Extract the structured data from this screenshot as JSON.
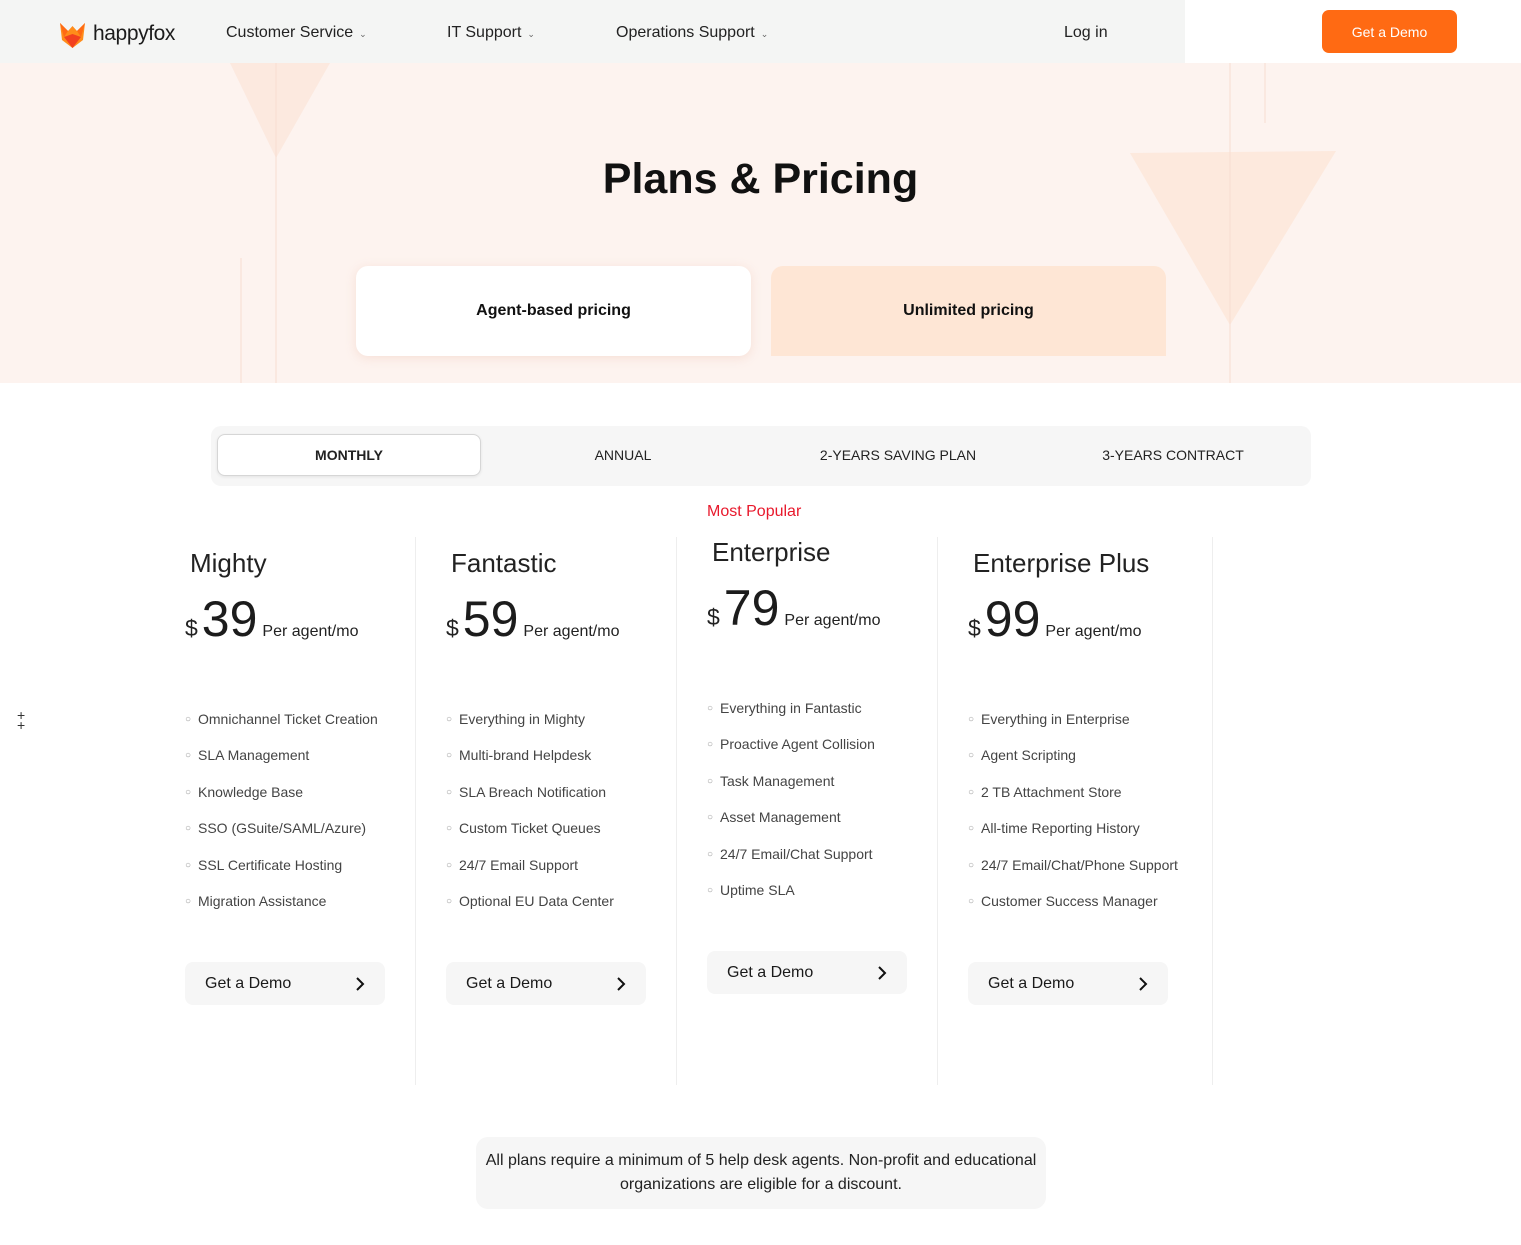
{
  "nav": {
    "brand": "happyfox",
    "items": [
      {
        "label": "Customer Service"
      },
      {
        "label": "IT Support"
      },
      {
        "label": "Operations Support"
      }
    ],
    "login": "Log in",
    "demo": "Get a Demo"
  },
  "hero": {
    "title": "Plans & Pricing",
    "tabs": [
      {
        "label": "Agent-based pricing",
        "selected": false
      },
      {
        "label": "Unlimited pricing",
        "selected": true
      }
    ]
  },
  "billing": {
    "options": [
      {
        "label": "MONTHLY",
        "selected": true
      },
      {
        "label": "ANNUAL",
        "selected": false
      },
      {
        "label": "2-YEARS SAVING PLAN",
        "selected": false
      },
      {
        "label": "3-YEARS CONTRACT",
        "selected": false
      }
    ]
  },
  "most_popular": "Most Popular",
  "plans": [
    {
      "name": "Mighty",
      "currency": "$",
      "price": "39",
      "unit": "Per agent/mo",
      "features": [
        "Omnichannel Ticket Creation",
        "SLA Management",
        "Knowledge Base",
        "SSO (GSuite/SAML/Azure)",
        "SSL Certificate Hosting",
        "Migration Assistance"
      ],
      "cta": "Get a Demo"
    },
    {
      "name": "Fantastic",
      "currency": "$",
      "price": "59",
      "unit": "Per agent/mo",
      "features": [
        "Everything in Mighty",
        "Multi-brand Helpdesk",
        "SLA Breach Notification",
        "Custom Ticket Queues",
        "24/7 Email Support",
        "Optional EU Data Center"
      ],
      "cta": "Get a Demo"
    },
    {
      "name": "Enterprise",
      "currency": "$",
      "price": "79",
      "unit": "Per agent/mo",
      "features": [
        "Everything in Fantastic",
        "Proactive Agent Collision",
        "Task Management",
        "Asset Management",
        "24/7 Email/Chat Support",
        "Uptime SLA"
      ],
      "cta": "Get a Demo"
    },
    {
      "name": "Enterprise Plus",
      "currency": "$",
      "price": "99",
      "unit": "Per agent/mo",
      "features": [
        "Everything in Enterprise",
        "Agent Scripting",
        "2 TB Attachment Store",
        "All-time Reporting History",
        "24/7 Email/Chat/Phone Support",
        "Customer Success Manager"
      ],
      "cta": "Get a Demo"
    }
  ],
  "expand_icon": "plus-icon",
  "footer_note": "All plans require a minimum of 5 help desk agents. Non-profit and educational organizations are eligible for a discount.",
  "colors": {
    "accent": "#ff6a13",
    "popular": "#e8192c",
    "hero_bg": "#fdf3ef",
    "selected_tab": "#fee6d5"
  }
}
